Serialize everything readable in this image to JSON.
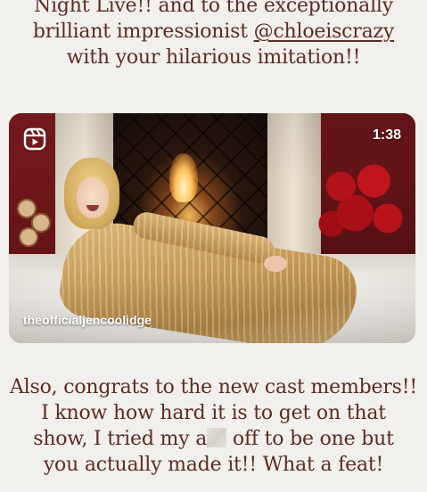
{
  "caption_top": {
    "line1": "Night Live!! and to the exceptionally",
    "line2_prefix": "brilliant impressionist ",
    "line2_mention": "@chloeiscrazy",
    "line3": "with your hilarious imitation!!"
  },
  "video": {
    "duration": "1:38",
    "username": "theofficialjencoolidge",
    "platform_icon": "reels-icon"
  },
  "caption_bottom": {
    "line1": "Also, congrats to the new cast members!!",
    "line2": "I know how hard it is to get on that",
    "line3_prefix": "show, I tried my a",
    "line3_suffix": " off to be one but",
    "line4": "you actually made it!! What a feat!"
  },
  "colors": {
    "background": "#f2f0ed",
    "text": "#5e2b23"
  }
}
